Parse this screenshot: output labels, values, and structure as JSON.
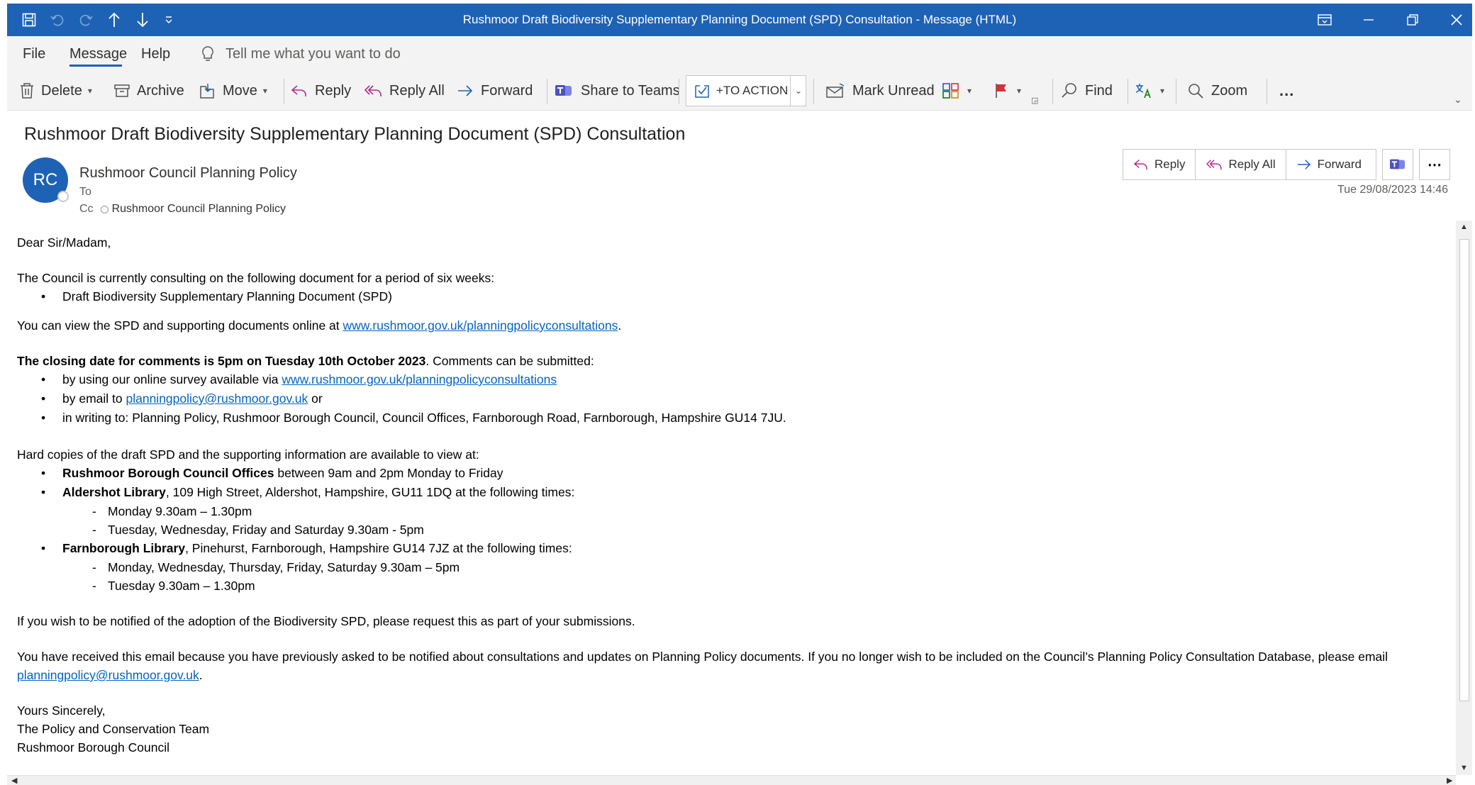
{
  "window": {
    "title": "Rushmoor Draft Biodiversity Supplementary Planning Document (SPD) Consultation  -  Message (HTML)",
    "accent": "#1e62b6"
  },
  "menu": {
    "file": "File",
    "message": "Message",
    "help": "Help",
    "tell_me": "Tell me what you want to do"
  },
  "ribbon": {
    "delete": "Delete",
    "archive": "Archive",
    "move": "Move",
    "reply": "Reply",
    "reply_all": "Reply All",
    "forward": "Forward",
    "share_to_teams": "Share to Teams",
    "to_action": "+TO ACTION",
    "mark_unread": "Mark Unread",
    "find": "Find",
    "zoom": "Zoom",
    "more": "..."
  },
  "message": {
    "subject": "Rushmoor Draft Biodiversity Supplementary Planning Document (SPD) Consultation",
    "avatar_initials": "RC",
    "sender": "Rushmoor Council Planning Policy",
    "to_label": "To",
    "cc_label": "Cc",
    "cc_value": "Rushmoor Council Planning Policy",
    "date": "Tue 29/08/2023 14:46",
    "actions": {
      "reply": "Reply",
      "reply_all": "Reply All",
      "forward": "Forward"
    }
  },
  "body": {
    "greeting": "Dear Sir/Madam,",
    "intro": "The Council is currently consulting on the following document for a period of six weeks:",
    "doc_item": "Draft Biodiversity Supplementary Planning Document (SPD)",
    "view_prefix": "You can view the SPD and supporting documents online at ",
    "url": "www.rushmoor.gov.uk/planningpolicyconsultations",
    "view_suffix": ".",
    "closing_bold": "The closing date for comments is 5pm on Tuesday 10th October 2023",
    "closing_rest": ". Comments can be submitted:",
    "survey_prefix": "by using our online survey available via ",
    "email_prefix": "by email to ",
    "email": "planningpolicy@rushmoor.gov.uk",
    "email_suffix": " or",
    "writing": "in writing to: Planning Policy, Rushmoor Borough Council, Council Offices, Farnborough Road, Farnborough, Hampshire GU14 7JU.",
    "hard_copies": "Hard copies of the draft SPD and the supporting information are available to view at:",
    "loc1_bold": "Rushmoor Borough Council Offices",
    "loc1_rest": " between 9am and 2pm Monday to Friday",
    "loc2_bold": "Aldershot Library",
    "loc2_rest": ", 109 High Street, Aldershot, Hampshire, GU11 1DQ at the following times:",
    "loc2_times": [
      "Monday 9.30am – 1.30pm",
      "Tuesday, Wednesday, Friday and Saturday 9.30am - 5pm"
    ],
    "loc3_bold": "Farnborough Library",
    "loc3_rest": ", Pinehurst, Farnborough, Hampshire GU14 7JZ at the following times:",
    "loc3_times": [
      "Monday, Wednesday, Thursday, Friday, Saturday 9.30am – 5pm",
      "Tuesday 9.30am – 1.30pm"
    ],
    "notify": "If you wish to be notified of the adoption of the Biodiversity SPD, please request this as part of your submissions.",
    "received": "You have received this email because you have previously asked to be notified about consultations and updates on Planning Policy documents. If you no longer wish to be included on the Council’s Planning Policy Consultation Database, please email",
    "period": ".",
    "signoff": "Yours Sincerely,",
    "team": "The Policy and Conservation Team",
    "council": "Rushmoor Borough Council"
  }
}
